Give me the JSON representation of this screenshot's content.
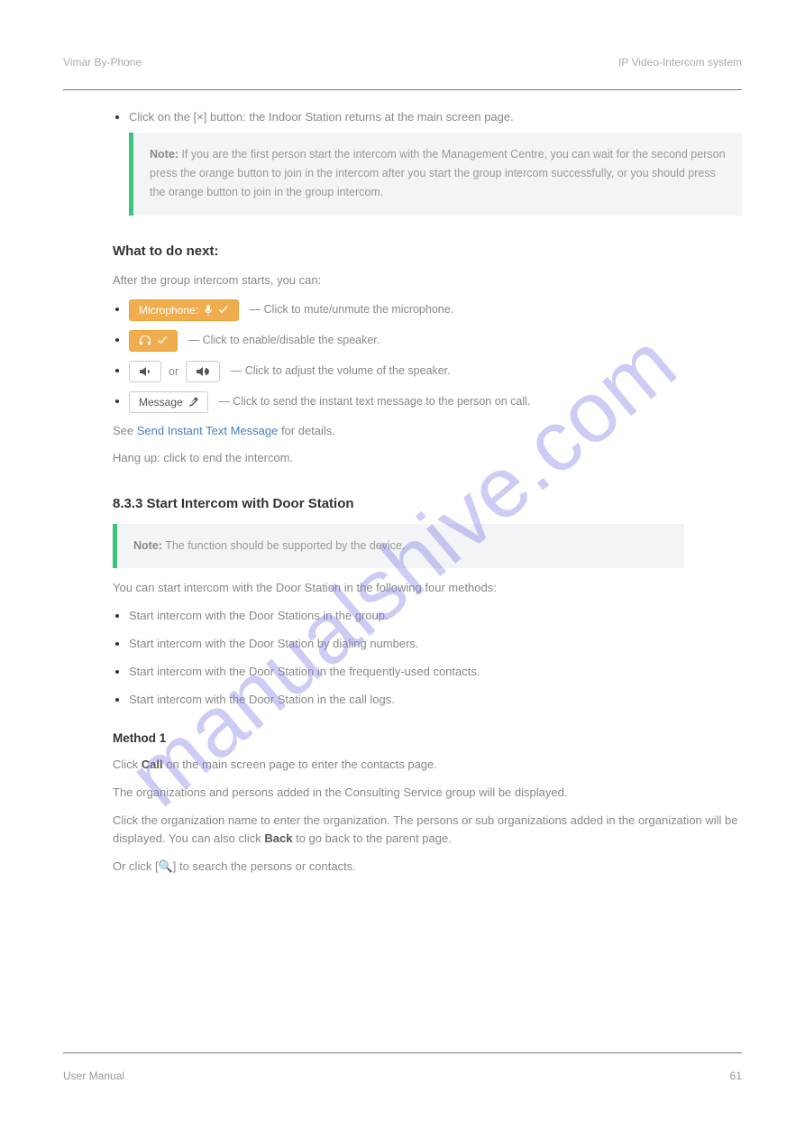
{
  "header": {
    "left": "Vimar By-Phone",
    "right": "IP Video-Intercom system"
  },
  "footer": {
    "left": "User Manual",
    "right": "61"
  },
  "watermark": "manualshive.com",
  "section1": {
    "bullet_lead": "Click on the [×] button:",
    "bullet_rest": " the Indoor Station returns at the main screen page.",
    "note_lead": "Note:",
    "note_body": " If you are the first person start the intercom with the Management Centre, you can wait for the second person press the orange button to join in the intercom after you start the group intercom successfully, or you should press the orange button to join in the group intercom."
  },
  "section2": {
    "title": "What to do next:",
    "intro": "After the group intercom starts, you can:",
    "items": [
      {
        "btn_label": "Microphone:",
        "post": "— Click to mute/unmute the microphone.",
        "type": "mic"
      },
      {
        "btn_label": "",
        "post": "— Click to enable/disable the speaker.",
        "type": "headphones"
      },
      {
        "btn_label_or": " or ",
        "post": "— Click to adjust the volume of the speaker.",
        "type": "volume"
      },
      {
        "btn_label": "Message",
        "post": "— Click to send the instant text message to the person on call.",
        "type": "message"
      }
    ],
    "after1": "See ",
    "after1_link": "Send Instant Text Message",
    "after1_rest": " for details.",
    "after2": "Hang up: click to end the intercom."
  },
  "section3": {
    "title": "8.3.3 Start Intercom with Door Station",
    "note_lead": "Note:",
    "note_body": " The function should be supported by the device.",
    "para": "You can start intercom with the Door Station in the following four methods:",
    "bullets": [
      "Start intercom with the Door Stations in the group.",
      "Start intercom with the Door Station by dialing numbers.",
      "Start intercom with the Door Station in the frequently-used contacts.",
      "Start intercom with the Door Station in the call logs."
    ]
  },
  "section4": {
    "title": "Method 1",
    "p1a": "Click ",
    "p1b": "Call",
    "p1c": " on the main screen page to enter the contacts page.",
    "p2": "The organizations and persons added in the Consulting Service group will be displayed.",
    "p3a": "Click the organization name to enter the organization. The persons or sub organizations added in the organization will be displayed. You can also click ",
    "p3b": "Back",
    "p3c": " to go back to the parent page.",
    "p4": "Or click [🔍] to search the persons or contacts."
  }
}
